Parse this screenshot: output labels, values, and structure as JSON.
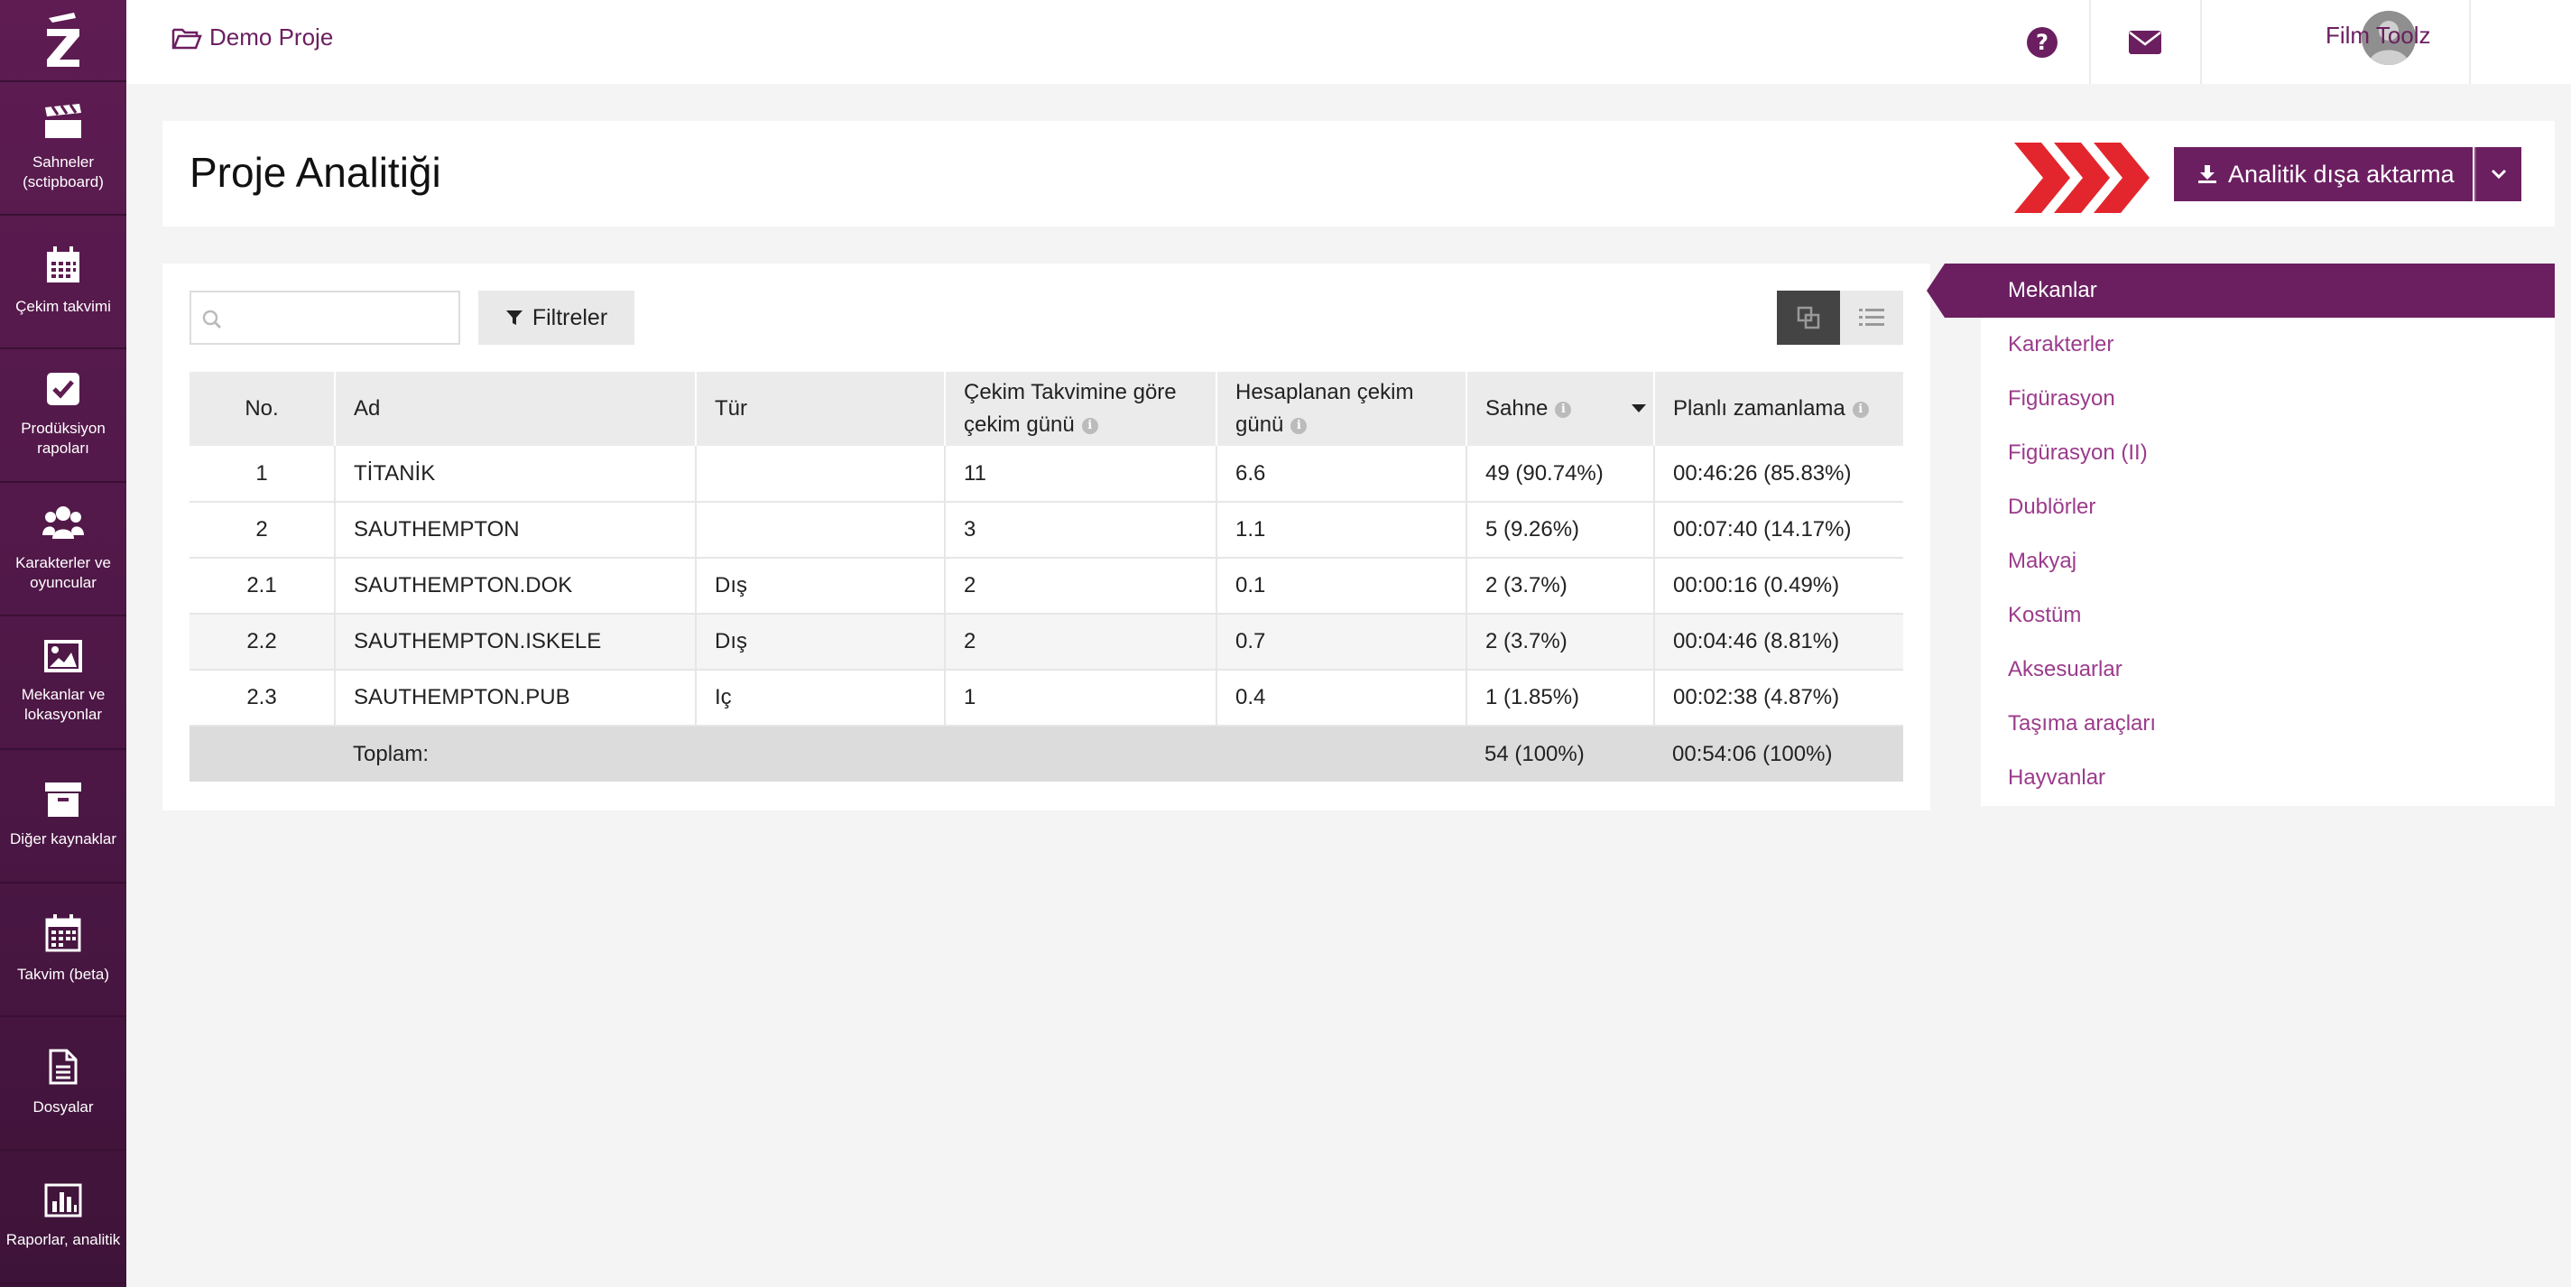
{
  "sidebar": {
    "logo": "Z",
    "items": [
      {
        "label": "Sahneler (sctipboard)",
        "icon": "clapperboard-icon"
      },
      {
        "label": "Çekim takvimi",
        "icon": "calendar-icon"
      },
      {
        "label": "Prodüksiyon rapoları",
        "icon": "checkbox-icon"
      },
      {
        "label": "Karakterler ve oyuncular",
        "icon": "users-icon"
      },
      {
        "label": "Mekanlar ve lokasyonlar",
        "icon": "image-icon"
      },
      {
        "label": "Diğer kaynaklar",
        "icon": "archive-icon"
      },
      {
        "label": "Takvim (beta)",
        "icon": "calendar-grid-icon"
      },
      {
        "label": "Dosyalar",
        "icon": "file-icon"
      },
      {
        "label": "Raporlar, analitik",
        "icon": "bar-chart-icon"
      }
    ]
  },
  "topbar": {
    "project": "Demo Proje",
    "user": "Film Toolz",
    "lang": "TR"
  },
  "header": {
    "title": "Proje Analitiği",
    "export_label": "Analitik dışa aktarma"
  },
  "toolbar": {
    "search_placeholder": "",
    "filter_label": "Filtreler"
  },
  "table": {
    "headers": {
      "no": "No.",
      "name": "Ad",
      "type": "Tür",
      "shoot_days_schedule_1": "Çekim Takvimine göre",
      "shoot_days_schedule_2": "çekim günü",
      "calc_days_1": "Hesaplanan çekim",
      "calc_days_2": "günü",
      "scene": "Sahne",
      "planned": "Planlı zamanlama"
    },
    "rows": [
      {
        "no": "1",
        "name": "TİTANİK",
        "type": "",
        "sched": "11",
        "calc": "6.6",
        "scene": "49 (90.74%)",
        "planned": "00:46:26 (85.83%)"
      },
      {
        "no": "2",
        "name": "SAUTHEMPTON",
        "type": "",
        "sched": "3",
        "calc": "1.1",
        "scene": "5 (9.26%)",
        "planned": "00:07:40 (14.17%)"
      },
      {
        "no": "2.1",
        "name": "SAUTHEMPTON.DOK",
        "type": "Dış",
        "sched": "2",
        "calc": "0.1",
        "scene": "2 (3.7%)",
        "planned": "00:00:16 (0.49%)"
      },
      {
        "no": "2.2",
        "name": "SAUTHEMPTON.ISKELE",
        "type": "Dış",
        "sched": "2",
        "calc": "0.7",
        "scene": "2 (3.7%)",
        "planned": "00:04:46 (8.81%)"
      },
      {
        "no": "2.3",
        "name": "SAUTHEMPTON.PUB",
        "type": "Iç",
        "sched": "1",
        "calc": "0.4",
        "scene": "1 (1.85%)",
        "planned": "00:02:38 (4.87%)"
      }
    ],
    "total": {
      "label": "Toplam:",
      "scene": "54 (100%)",
      "planned": "00:54:06 (100%)"
    }
  },
  "right_menu": {
    "items": [
      "Mekanlar",
      "Karakterler",
      "Figürasyon",
      "Figürasyon (II)",
      "Dublörler",
      "Makyaj",
      "Kostüm",
      "Aksesuarlar",
      "Taşıma araçları",
      "Hayvanlar"
    ],
    "active": "Mekanlar"
  },
  "colors": {
    "brand": "#6b1f60",
    "accent_red": "#e3262d",
    "menu_link": "#9b3b8b"
  }
}
